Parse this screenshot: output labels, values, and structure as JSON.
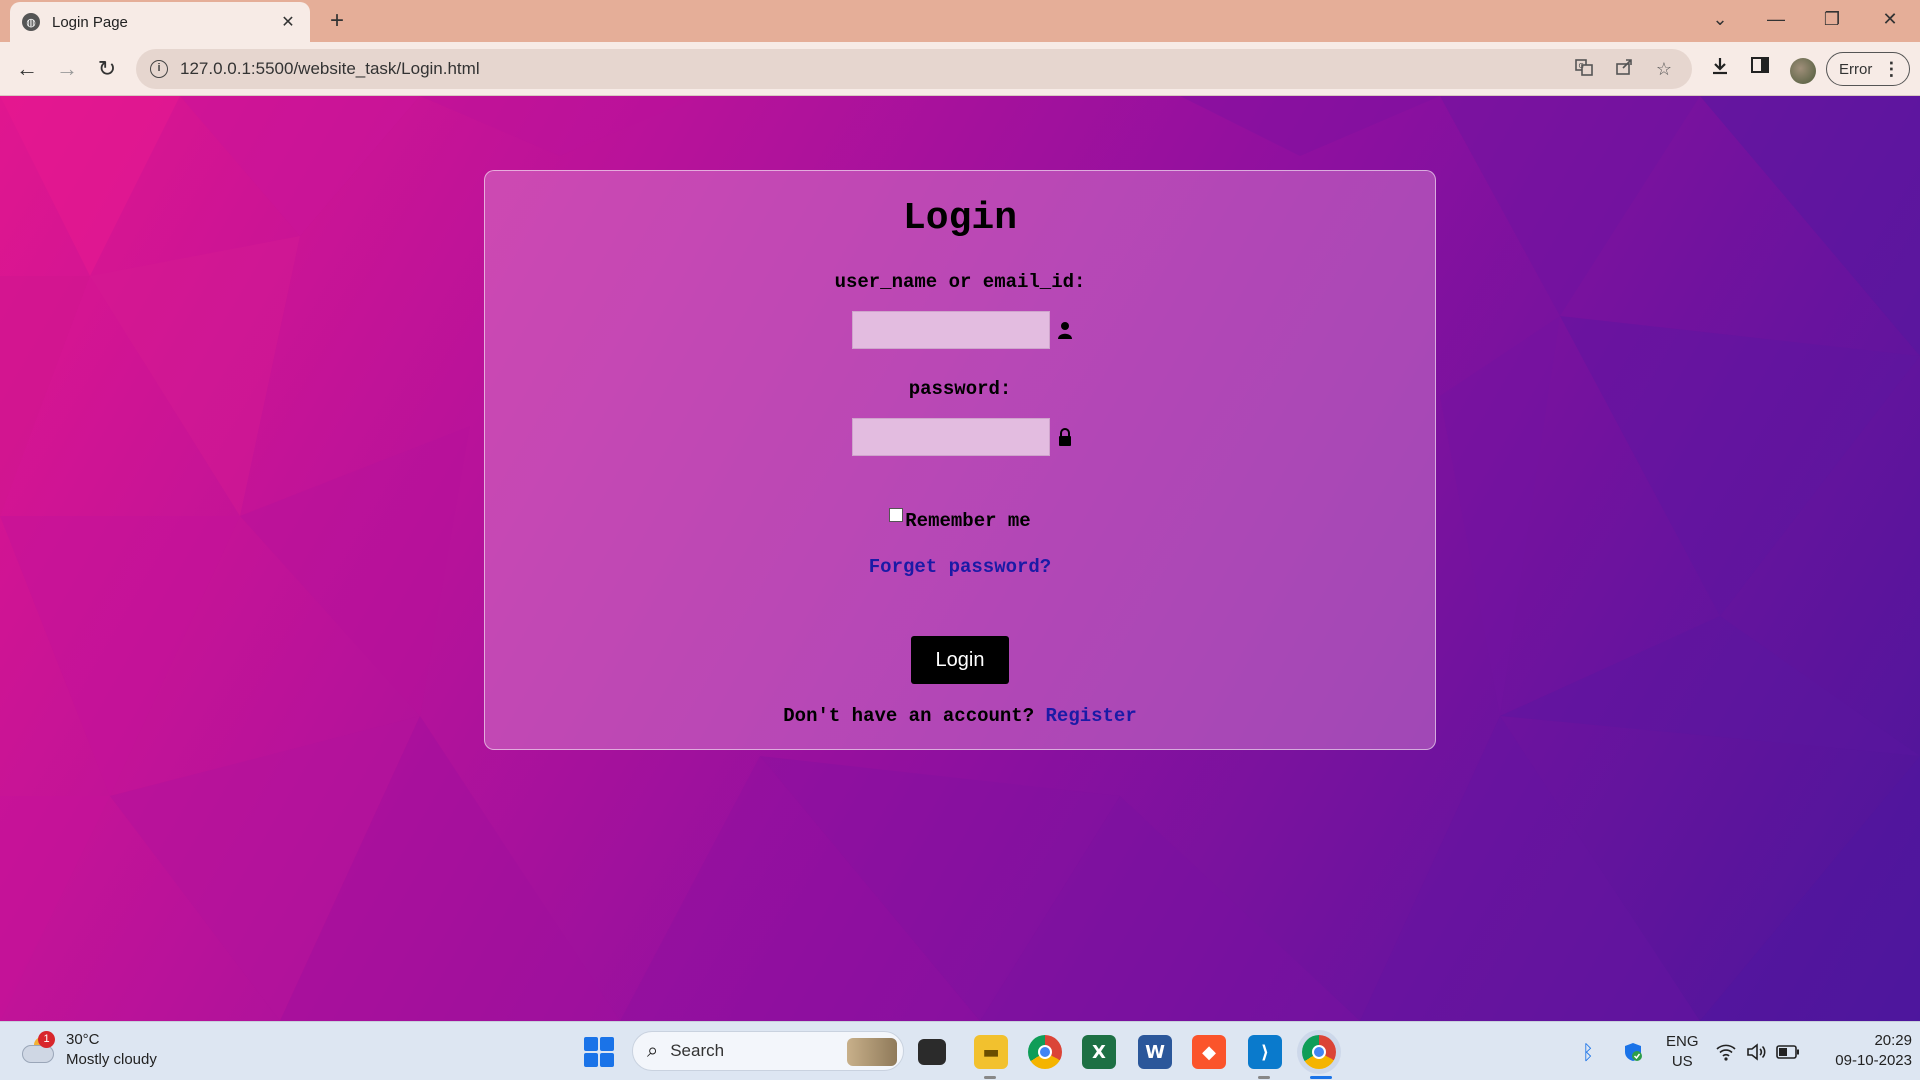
{
  "browser": {
    "tab_title": "Login Page",
    "tab_close": "✕",
    "new_tab": "+",
    "url": "127.0.0.1:5500/website_task/Login.html",
    "profile_status": "Error",
    "window_controls": {
      "dropdown": "⌄",
      "minimize": "—",
      "restore": "❐",
      "close": "✕"
    },
    "nav": {
      "back": "←",
      "forward": "→",
      "reload": "↻"
    },
    "icons": [
      "translate-icon",
      "share-icon",
      "star-icon",
      "download-icon",
      "sidepanel-icon",
      "avatar",
      "menu-icon"
    ]
  },
  "login": {
    "heading": "Login",
    "username_label": "user_name or email_id:",
    "username_value": "",
    "password_label": "password:",
    "password_value": "",
    "remember_label": "Remember me",
    "remember_checked": false,
    "forgot_link": "Forget password?",
    "submit_label": "Login",
    "signup_prompt": "Don't have an account?",
    "signup_link": "Register",
    "link_color": "#1a1aa6",
    "button_color": "#000000"
  },
  "taskbar": {
    "weather": {
      "temp": "30°C",
      "condition": "Mostly cloudy",
      "badge": "1"
    },
    "search_label": "Search",
    "apps": [
      "task-view",
      "file-explorer",
      "chrome",
      "excel",
      "word",
      "brave",
      "vscode",
      "chrome-profile"
    ],
    "tray": {
      "lang_top": "ENG",
      "lang_bottom": "US"
    },
    "clock": {
      "time": "20:29",
      "date": "09-10-2023"
    }
  },
  "colors": {
    "bg_start": "#e0168f",
    "bg_end": "#4b169a",
    "chrome_bg": "#e5ae98",
    "toolbar_bg": "#f7ebe6"
  }
}
